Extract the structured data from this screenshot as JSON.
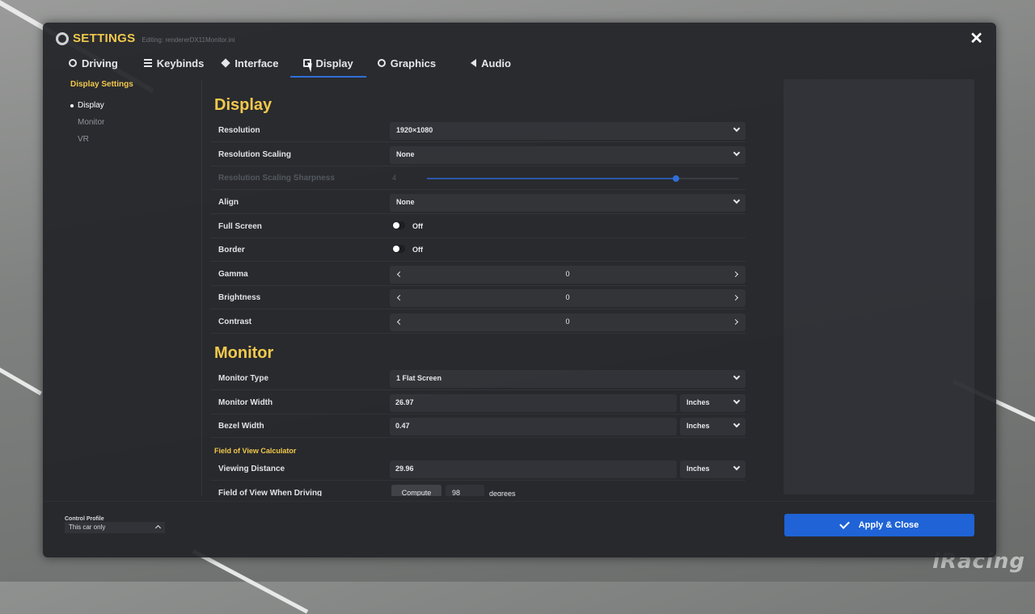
{
  "header": {
    "title": "SETTINGS",
    "editing": "Editing: rendererDX11Monitor.ini"
  },
  "tabs": [
    {
      "label": "Driving",
      "icon": "steering-wheel-icon"
    },
    {
      "label": "Keybinds",
      "icon": "keybinds-icon"
    },
    {
      "label": "Interface",
      "icon": "layers-icon"
    },
    {
      "label": "Display",
      "icon": "monitor-icon",
      "active": true
    },
    {
      "label": "Graphics",
      "icon": "graphics-icon"
    },
    {
      "label": "Audio",
      "icon": "speaker-icon"
    }
  ],
  "sidebar": {
    "title": "Display Settings",
    "items": [
      "Display",
      "Monitor",
      "VR"
    ]
  },
  "display": {
    "heading": "Display",
    "resolution": {
      "label": "Resolution",
      "value": "1920×1080"
    },
    "scaling": {
      "label": "Resolution Scaling",
      "value": "None"
    },
    "sharpness": {
      "label": "Resolution Scaling Sharpness",
      "value": "4",
      "level": 0.8
    },
    "align": {
      "label": "Align",
      "value": "None"
    },
    "fullscreen": {
      "label": "Full Screen",
      "value": "Off"
    },
    "border": {
      "label": "Border",
      "value": "Off"
    },
    "gamma": {
      "label": "Gamma",
      "value": "0"
    },
    "brightness": {
      "label": "Brightness",
      "value": "0"
    },
    "contrast": {
      "label": "Contrast",
      "value": "0"
    }
  },
  "monitor": {
    "heading": "Monitor",
    "type": {
      "label": "Monitor Type",
      "value": "1 Flat Screen"
    },
    "width": {
      "label": "Monitor Width",
      "value": "26.97",
      "unit": "Inches"
    },
    "bezel": {
      "label": "Bezel Width",
      "value": "0.47",
      "unit": "Inches"
    },
    "fov_heading": "Field of View Calculator",
    "viewing": {
      "label": "Viewing Distance",
      "value": "29.96",
      "unit": "Inches"
    },
    "fov": {
      "label": "Field of View When Driving",
      "compute": "Compute",
      "value": "98",
      "unit": "degrees"
    }
  },
  "footer": {
    "control_profile_label": "Control Profile",
    "control_profile_value": "This car only",
    "apply_label": "Apply & Close"
  },
  "watermark": "iRacing",
  "colors": {
    "accent": "#f2c94c",
    "primary": "#1f63d6",
    "panel": "#222428"
  }
}
